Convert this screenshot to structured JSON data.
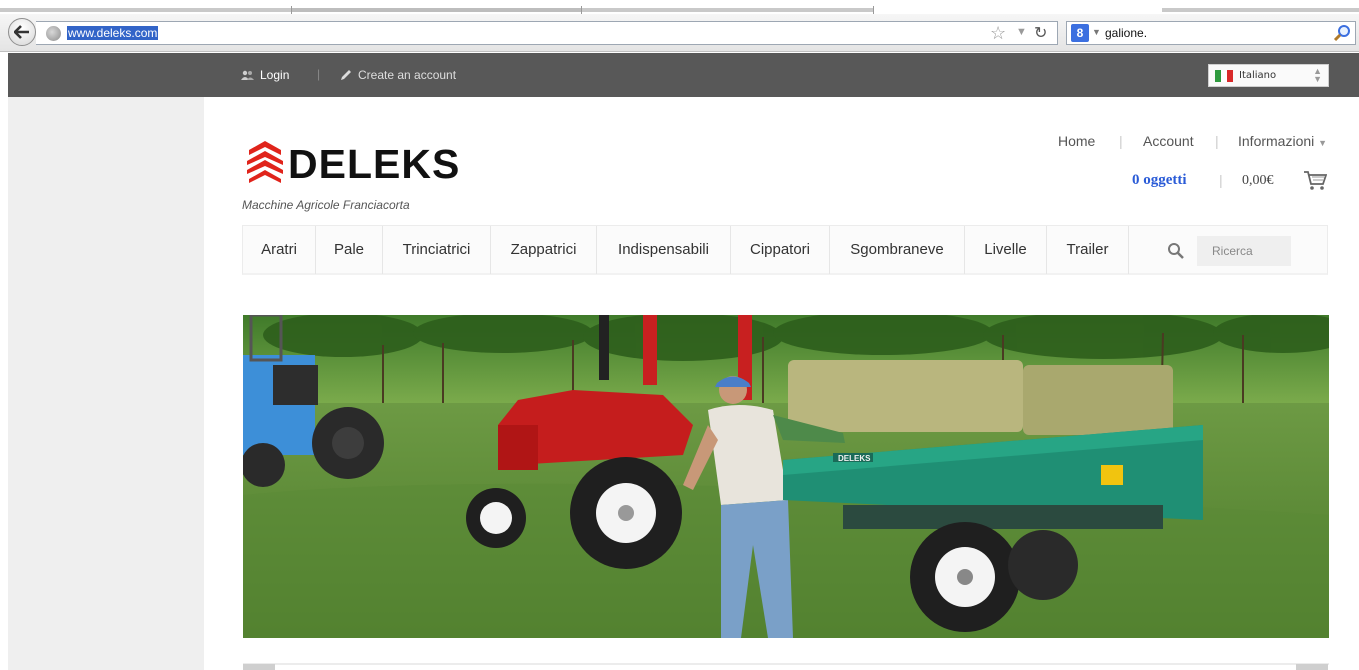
{
  "browser": {
    "url": "www.deleks.com",
    "search_query": "galione."
  },
  "topbar": {
    "login": "Login",
    "divider": "|",
    "create_account": "Create an account",
    "language": "Italiano"
  },
  "brand": {
    "name": "DELEKS",
    "tagline": "Macchine Agricole Franciacorta",
    "accent_color": "#e0241b"
  },
  "header_links": {
    "home": "Home",
    "account": "Account",
    "info": "Informazioni",
    "separator": "|"
  },
  "cart": {
    "items": "0 oggetti",
    "separator": "|",
    "total": "0,00€"
  },
  "menu": {
    "items": [
      "Aratri",
      "Pale",
      "Trinciatrici",
      "Zappatrici",
      "Indispensabili",
      "Cippatori",
      "Sgombraneve",
      "Livelle",
      "Trailer"
    ],
    "search_placeholder": "Ricerca"
  },
  "hero": {
    "trailer_brand": "DELEKS"
  }
}
